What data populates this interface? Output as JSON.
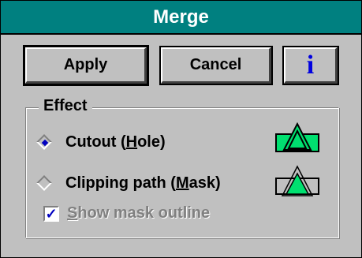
{
  "window": {
    "title": "Merge"
  },
  "buttons": {
    "apply": "Apply",
    "cancel": "Cancel",
    "info_icon": "info-icon"
  },
  "effect": {
    "group_label": "Effect",
    "options": [
      {
        "label_pre": "Cutout (",
        "mnemonic": "H",
        "label_post": "ole)",
        "selected": true,
        "icon": "cutout-hole-icon"
      },
      {
        "label_pre": "Clipping path (",
        "mnemonic": "M",
        "label_post": "ask)",
        "selected": false,
        "icon": "clipping-mask-icon"
      }
    ],
    "show_mask": {
      "mnemonic": "S",
      "label_rest": "how mask outline",
      "checked": true,
      "enabled": false
    }
  },
  "colors": {
    "titlebar": "#008080",
    "accent_green": "#00e070",
    "info_blue": "#0000e0"
  }
}
